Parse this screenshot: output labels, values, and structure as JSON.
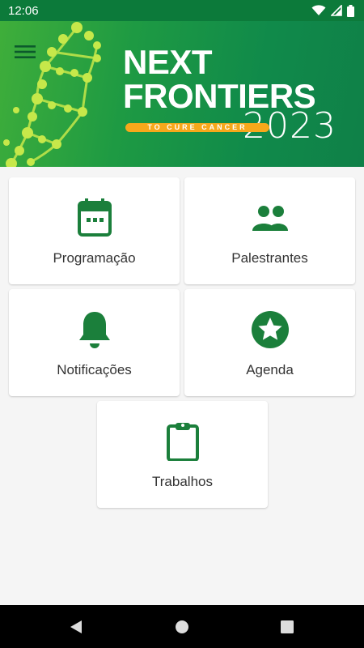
{
  "status_bar": {
    "time": "12:06"
  },
  "banner": {
    "title_line1": "NEXT",
    "title_line2": "FRONTIERS",
    "tagline": "TO CURE CANCER",
    "year": "2023"
  },
  "menu": [
    {
      "label": "Programação",
      "icon": "calendar-icon"
    },
    {
      "label": "Palestrantes",
      "icon": "people-icon"
    },
    {
      "label": "Notificações",
      "icon": "bell-icon"
    },
    {
      "label": "Agenda",
      "icon": "star-icon"
    },
    {
      "label": "Trabalhos",
      "icon": "clipboard-icon"
    }
  ],
  "colors": {
    "primary": "#0c7a3a",
    "accent": "#f7a81b",
    "icon": "#1b7f3b"
  }
}
